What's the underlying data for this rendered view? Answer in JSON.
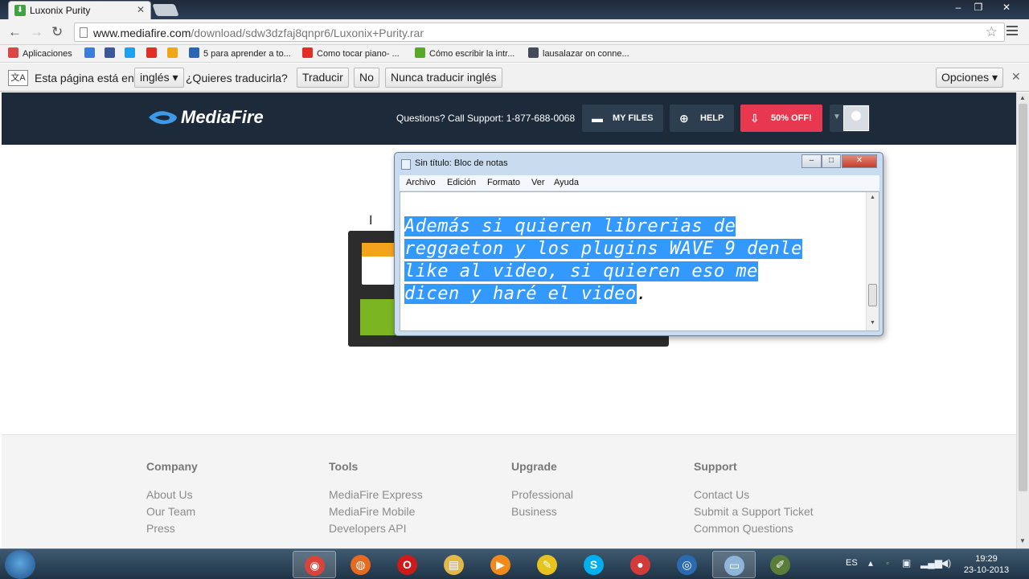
{
  "browser": {
    "tab_title": "Luxonix Purity",
    "url_host": "www.mediafire.com",
    "url_path": "/download/sdw3dzfaj8qnpr6/Luxonix+Purity.rar",
    "bookmarks": [
      {
        "label": "Aplicaciones",
        "icon": "apps-grid-icon",
        "color": "#d44"
      },
      {
        "label": "",
        "icon": "bookmark-g-icon",
        "color": "#3b7ddd"
      },
      {
        "label": "",
        "icon": "facebook-icon",
        "color": "#3b5998"
      },
      {
        "label": "",
        "icon": "twitter-icon",
        "color": "#1da1f2"
      },
      {
        "label": "",
        "icon": "youtube-icon",
        "color": "#e52d27"
      },
      {
        "label": "",
        "icon": "windows-live-icon",
        "color": "#f2a612"
      },
      {
        "label": "5 para aprender a to...",
        "icon": "ti-icon",
        "color": "#2b66b5"
      },
      {
        "label": "Como tocar piano- ...",
        "icon": "youtube-icon",
        "color": "#e52d27"
      },
      {
        "label": "Cómo escribir la intr...",
        "icon": "e-icon",
        "color": "#59a82a"
      },
      {
        "label": "lausalazar on conne...",
        "icon": "page-icon",
        "color": "#444a5a"
      }
    ]
  },
  "translate_bar": {
    "prefix": "Esta página está en",
    "language": "inglés",
    "question": "¿Quieres traducirla?",
    "translate_btn": "Traducir",
    "no_btn": "No",
    "never_btn": "Nunca traducir inglés",
    "options_btn": "Opciones"
  },
  "mediafire": {
    "logo": "MediaFire",
    "support": "Questions? Call Support: 1-877-688-0068",
    "my_files": "MY FILES",
    "help": "HELP",
    "promo": "50% OFF!",
    "footer": [
      {
        "heading": "Company",
        "links": [
          "About Us",
          "Our Team",
          "Press"
        ]
      },
      {
        "heading": "Tools",
        "links": [
          "MediaFire Express",
          "MediaFire Mobile",
          "Developers API"
        ]
      },
      {
        "heading": "Upgrade",
        "links": [
          "Professional",
          "Business"
        ]
      },
      {
        "heading": "Support",
        "links": [
          "Contact Us",
          "Submit a Support Ticket",
          "Common Questions"
        ]
      }
    ]
  },
  "notepad": {
    "title": "Sin título: Bloc de notas",
    "menus": [
      "Archivo",
      "Edición",
      "Formato",
      "Ver",
      "Ayuda"
    ],
    "lines": [
      "Además si  quieren librerias de",
      "reggaeton y los plugins WAVE 9 denle",
      "like al video, si quieren eso me",
      "dicen y haré el video"
    ],
    "trailing": "."
  },
  "taskbar": {
    "language": "ES",
    "time": "19:29",
    "date": "23-10-2013",
    "apps": [
      {
        "icon": "chrome-icon",
        "color": "#d9443a",
        "active": true
      },
      {
        "icon": "firefox-icon",
        "color": "#e66a1f",
        "active": false
      },
      {
        "icon": "opera-icon",
        "color": "#cc1b1b",
        "active": false
      },
      {
        "icon": "explorer-folder-icon",
        "color": "#e3b84a",
        "active": false
      },
      {
        "icon": "media-player-icon",
        "color": "#f08a1c",
        "active": false
      },
      {
        "icon": "fl-studio-icon",
        "color": "#e8c21d",
        "active": false
      },
      {
        "icon": "skype-icon",
        "color": "#00aff0",
        "active": false
      },
      {
        "icon": "recorder-icon",
        "color": "#d33b3b",
        "active": false
      },
      {
        "icon": "media-center-icon",
        "color": "#2a6ab0",
        "active": false
      },
      {
        "icon": "notepad-icon",
        "color": "#8fb6d8",
        "active": true
      },
      {
        "icon": "paint-icon",
        "color": "#5a7d3a",
        "active": false
      }
    ]
  }
}
